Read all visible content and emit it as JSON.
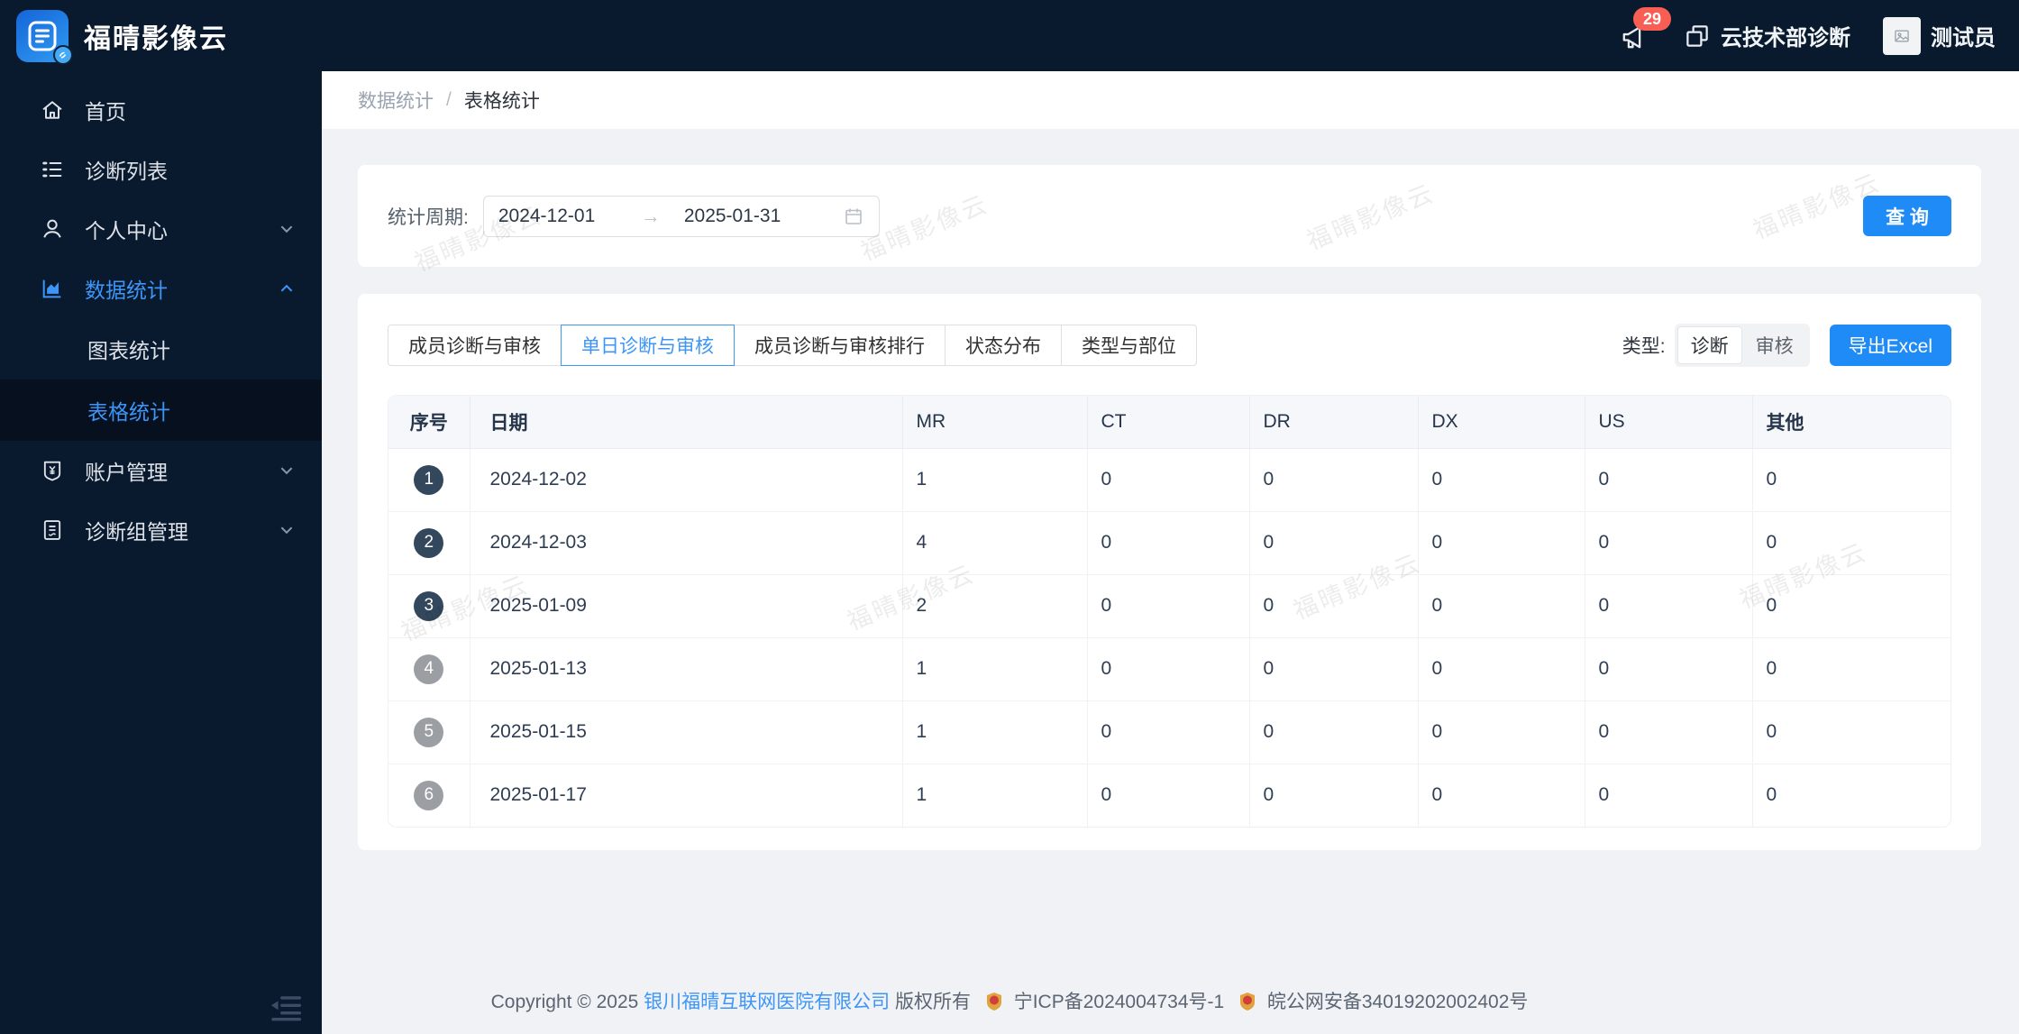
{
  "app": {
    "title": "福晴影像云"
  },
  "header": {
    "notification_count": "29",
    "org_name": "云技术部诊断",
    "user_name": "测试员"
  },
  "sidebar": {
    "items": [
      {
        "label": "首页"
      },
      {
        "label": "诊断列表"
      },
      {
        "label": "个人中心"
      },
      {
        "label": "数据统计"
      },
      {
        "label": "图表统计"
      },
      {
        "label": "表格统计"
      },
      {
        "label": "账户管理"
      },
      {
        "label": "诊断组管理"
      }
    ]
  },
  "breadcrumb": {
    "parent": "数据统计",
    "separator": "/",
    "current": "表格统计"
  },
  "filter": {
    "label": "统计周期:",
    "date_start": "2024-12-01",
    "date_range_separator": "→",
    "date_end": "2025-01-31",
    "query_button": "查 询"
  },
  "tabs": [
    {
      "label": "成员诊断与审核",
      "active": false
    },
    {
      "label": "单日诊断与审核",
      "active": true
    },
    {
      "label": "成员诊断与审核排行",
      "active": false
    },
    {
      "label": "状态分布",
      "active": false
    },
    {
      "label": "类型与部位",
      "active": false
    }
  ],
  "toolbar": {
    "type_label": "类型:",
    "type_options": [
      "诊断",
      "审核"
    ],
    "type_selected": "诊断",
    "export_button": "导出Excel"
  },
  "table": {
    "columns": [
      {
        "label": "序号",
        "bold": true
      },
      {
        "label": "日期",
        "bold": true
      },
      {
        "label": "MR",
        "bold": false
      },
      {
        "label": "CT",
        "bold": false
      },
      {
        "label": "DR",
        "bold": false
      },
      {
        "label": "DX",
        "bold": false
      },
      {
        "label": "US",
        "bold": false
      },
      {
        "label": "其他",
        "bold": true
      }
    ],
    "rows": [
      {
        "no": "1",
        "date": "2024-12-02",
        "values": [
          "1",
          "0",
          "0",
          "0",
          "0",
          "0"
        ]
      },
      {
        "no": "2",
        "date": "2024-12-03",
        "values": [
          "4",
          "0",
          "0",
          "0",
          "0",
          "0"
        ]
      },
      {
        "no": "3",
        "date": "2025-01-09",
        "values": [
          "2",
          "0",
          "0",
          "0",
          "0",
          "0"
        ]
      },
      {
        "no": "4",
        "date": "2025-01-13",
        "values": [
          "1",
          "0",
          "0",
          "0",
          "0",
          "0"
        ]
      },
      {
        "no": "5",
        "date": "2025-01-15",
        "values": [
          "1",
          "0",
          "0",
          "0",
          "0",
          "0"
        ]
      },
      {
        "no": "6",
        "date": "2025-01-17",
        "values": [
          "1",
          "0",
          "0",
          "0",
          "0",
          "0"
        ]
      }
    ]
  },
  "watermark": {
    "text": "福晴影像云"
  },
  "footer": {
    "copyright": "Copyright © 2025",
    "company": "银川福晴互联网医院有限公司",
    "rights": "版权所有",
    "icp": "宁ICP备2024004734号-1",
    "security": "皖公网安备34019202002402号"
  },
  "colors": {
    "header_sidebar_bg": "#0a1a2e",
    "accent_button": "#1f8bf6",
    "accent_text": "#3d96f7",
    "notification_badge": "#f95e55",
    "rank_badge_top3": "#33485c",
    "rank_badge_default": "#9b9ea3",
    "table_header_bg": "#f5f7fa",
    "page_bg": "#f0f2f5"
  }
}
